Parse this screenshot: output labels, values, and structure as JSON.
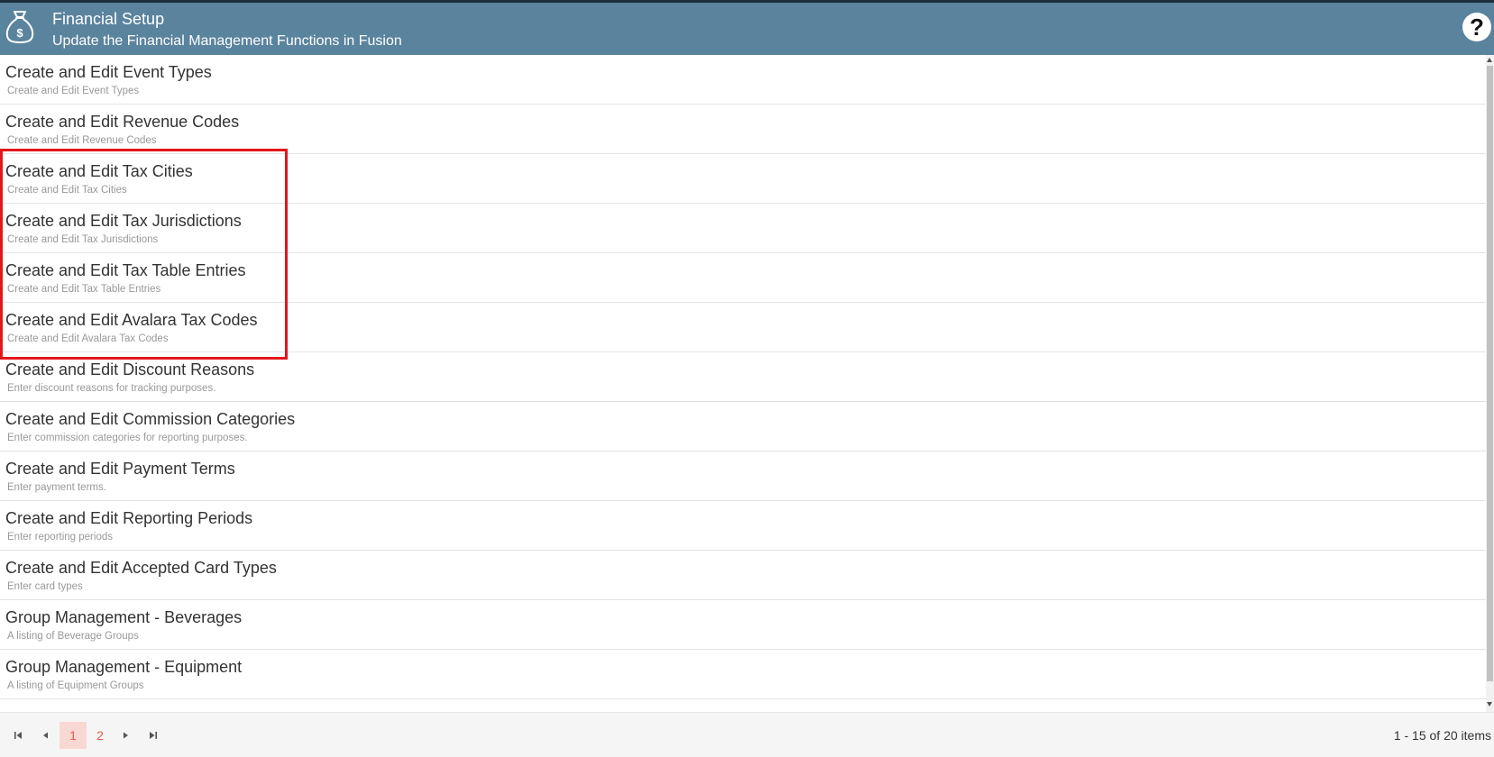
{
  "header": {
    "title": "Financial Setup",
    "subtitle": "Update the Financial Management Functions in Fusion",
    "logo_icon": "money-bag-icon",
    "help_icon": "help-icon",
    "help_glyph": "?",
    "background_color": "#5a839e"
  },
  "items": [
    {
      "title": "Create and Edit Event Types",
      "description": "Create and Edit Event Types"
    },
    {
      "title": "Create and Edit Revenue Codes",
      "description": "Create and Edit Revenue Codes"
    },
    {
      "title": "Create and Edit Tax Cities",
      "description": "Create and Edit Tax Cities"
    },
    {
      "title": "Create and Edit Tax Jurisdictions",
      "description": "Create and Edit Tax Jurisdictions"
    },
    {
      "title": "Create and Edit Tax Table Entries",
      "description": "Create and Edit Tax Table Entries"
    },
    {
      "title": "Create and Edit Avalara Tax Codes",
      "description": "Create and Edit Avalara Tax Codes"
    },
    {
      "title": "Create and Edit Discount Reasons",
      "description": "Enter discount reasons for tracking purposes."
    },
    {
      "title": "Create and Edit Commission Categories",
      "description": "Enter commission categories for reporting purposes."
    },
    {
      "title": "Create and Edit Payment Terms",
      "description": "Enter payment terms."
    },
    {
      "title": "Create and Edit Reporting Periods",
      "description": "Enter reporting periods"
    },
    {
      "title": "Create and Edit Accepted Card Types",
      "description": "Enter card types"
    },
    {
      "title": "Group Management - Beverages",
      "description": "A listing of Beverage Groups"
    },
    {
      "title": "Group Management - Equipment",
      "description": "A listing of Equipment Groups"
    }
  ],
  "highlight": {
    "color": "#e3161b",
    "items": [
      "Create and Edit Tax Cities",
      "Create and Edit Tax Jurisdictions",
      "Create and Edit Tax Table Entries",
      "Create and Edit Avalara Tax Codes"
    ]
  },
  "pager": {
    "first_icon": "first-page-icon",
    "prev_icon": "previous-page-icon",
    "next_icon": "next-page-icon",
    "last_icon": "last-page-icon",
    "pages": [
      "1",
      "2"
    ],
    "current_page": "1",
    "info": "1 - 15 of 20 items",
    "accent_color": "#e35b4b"
  }
}
